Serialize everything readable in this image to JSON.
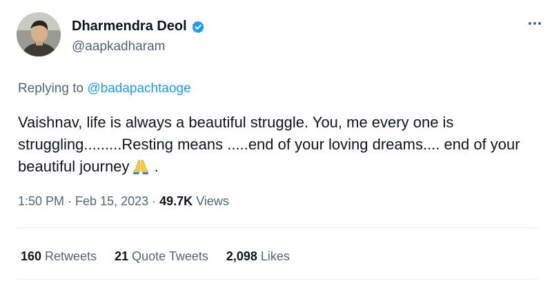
{
  "author": {
    "display_name": "Dharmendra Deol",
    "handle": "@aapkadharam",
    "verified_icon": "verified-badge-icon",
    "verified_color": "#1d9bf0"
  },
  "reply": {
    "prefix": "Replying to ",
    "mention": "@badapachtaoge"
  },
  "tweet": {
    "lines": [
      "Vaishnav, life is always a beautiful struggle. You, me every one is",
      "struggling.........Resting means .....end of your loving dreams.... end of your",
      "beautiful journey"
    ],
    "trailing": " .",
    "emoji": "folded-hands-icon"
  },
  "meta": {
    "time": "1:50 PM",
    "separator": " · ",
    "date": "Feb 15, 2023",
    "views_count": "49.7K",
    "views_label": " Views"
  },
  "stats": {
    "retweets_count": "160",
    "retweets_label": " Retweets",
    "quotes_count": "21",
    "quotes_label": " Quote Tweets",
    "likes_count": "2,098",
    "likes_label": " Likes"
  },
  "colors": {
    "text": "#0f1419",
    "secondary": "#536471",
    "accent": "#1d9bf0",
    "divider": "#eff3f4"
  }
}
